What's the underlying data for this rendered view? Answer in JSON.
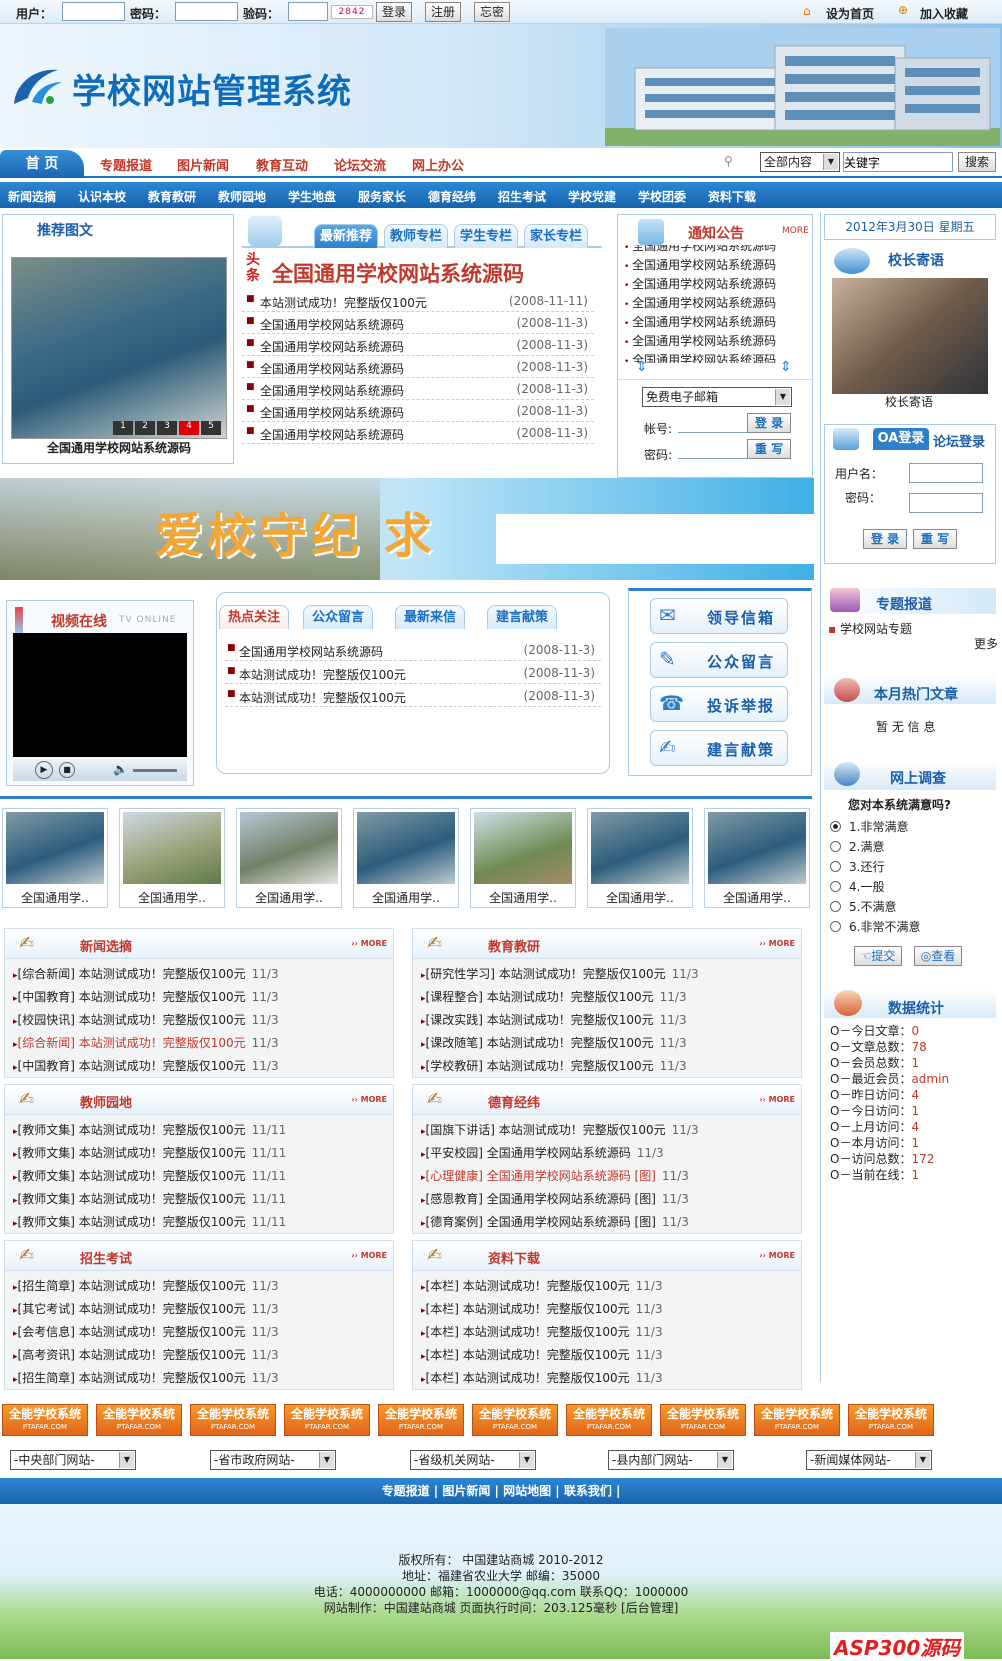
{
  "topbar": {
    "user_label": "用户：",
    "pwd_label": "密码：",
    "code_label": "验码：",
    "captcha": "2842",
    "login": "登录",
    "register": "注册",
    "forgot": "忘密",
    "set_home": "设为首页",
    "favorite": "加入收藏"
  },
  "banner": {
    "title": "学校网站管理系统"
  },
  "nav": {
    "home": "首 页",
    "links": [
      "专题报道",
      "图片新闻",
      "教育互动",
      "论坛交流",
      "网上办公"
    ],
    "search_scope": "全部内容",
    "search_value": "关键字",
    "search_button": "搜索"
  },
  "subnav": [
    "新闻选摘",
    "认识本校",
    "教育教研",
    "教师园地",
    "学生地盘",
    "服务家长",
    "德育经纬",
    "招生考试",
    "学校党建",
    "学校团委",
    "资料下载"
  ],
  "recommend": {
    "title": "推荐图文",
    "caption": "全国通用学校网站系统源码",
    "pages": [
      "1",
      "2",
      "3",
      "4",
      "5"
    ]
  },
  "latest": {
    "tabs": [
      "最新推荐",
      "教师专栏",
      "学生专栏",
      "家长专栏"
    ],
    "headline_tag": "头条",
    "headline": "全国通用学校网站系统源码",
    "items": [
      {
        "title": "本站测试成功！完整版仅100元",
        "date": "(2008-11-11)"
      },
      {
        "title": "全国通用学校网站系统源码",
        "date": "(2008-11-3)"
      },
      {
        "title": "全国通用学校网站系统源码",
        "date": "(2008-11-3)"
      },
      {
        "title": "全国通用学校网站系统源码",
        "date": "(2008-11-3)"
      },
      {
        "title": "全国通用学校网站系统源码",
        "date": "(2008-11-3)"
      },
      {
        "title": "全国通用学校网站系统源码",
        "date": "(2008-11-3)"
      },
      {
        "title": "全国通用学校网站系统源码",
        "date": "(2008-11-3)"
      }
    ]
  },
  "notice": {
    "title": "通知公告",
    "more": "MORE",
    "items": [
      "全国通用学校网站系统源码",
      "全国通用学校网站系统源码",
      "全国通用学校网站系统源码",
      "全国通用学校网站系统源码",
      "全国通用学校网站系统源码",
      "全国通用学校网站系统源码",
      "全国通用学校网站系统源码"
    ],
    "mail_select": "免费电子邮箱",
    "account_label": "帐号:",
    "password_label": "密码:",
    "login": "登 录",
    "reset": "重 写"
  },
  "right": {
    "date": "2012年3月30日 星期五",
    "principal_title": "校长寄语",
    "principal_caption": "校长寄语",
    "oa_tab": "OA登录",
    "forum_tab": "论坛登录",
    "user_label": "用户名：",
    "pwd_label": "密码：",
    "login": "登 录",
    "reset": "重 写",
    "topic_title": "专题报道",
    "topic_item": "学校网站专题",
    "topic_more": "更多",
    "hot_title": "本月热门文章",
    "hot_empty": "暂 无 信 息",
    "survey_title": "网上调查",
    "survey_question": "您对本系统满意吗?",
    "survey_options": [
      "1.非常满意",
      "2.满意",
      "3.还行",
      "4.一般",
      "5.不满意",
      "6.非常不满意"
    ],
    "submit": "提交",
    "view": "查看",
    "stats_title": "数据统计",
    "stats": [
      {
        "label": "O－今日文章：",
        "value": "0"
      },
      {
        "label": "O－文章总数：",
        "value": "78"
      },
      {
        "label": "O－会员总数：",
        "value": "1"
      },
      {
        "label": "O－最近会员：",
        "value": "admin"
      },
      {
        "label": "O－昨日访问：",
        "value": "4"
      },
      {
        "label": "O－今日访问：",
        "value": "1"
      },
      {
        "label": "O－上月访问：",
        "value": "4"
      },
      {
        "label": "O－本月访问：",
        "value": "1"
      },
      {
        "label": "O－访问总数：",
        "value": "172"
      },
      {
        "label": "O－当前在线：",
        "value": "1"
      }
    ]
  },
  "slogan": {
    "text": "爱校守纪 求"
  },
  "video": {
    "title": "视频在线",
    "subtitle": "TV ONLINE"
  },
  "hot": {
    "tabs": [
      "热点关注",
      "公众留言",
      "最新来信",
      "建言献策"
    ],
    "items": [
      {
        "title": "全国通用学校网站系统源码",
        "date": "(2008-11-3)"
      },
      {
        "title": "本站测试成功！完整版仅100元",
        "date": "(2008-11-3)"
      },
      {
        "title": "本站测试成功！完整版仅100元",
        "date": "(2008-11-3)"
      }
    ]
  },
  "service_buttons": [
    "领导信箱",
    "公众留言",
    "投诉举报",
    "建言献策"
  ],
  "thumbs": [
    "全国通用学..",
    "全国通用学..",
    "全国通用学..",
    "全国通用学..",
    "全国通用学..",
    "全国通用学..",
    "全国通用学.."
  ],
  "sections": [
    {
      "title": "新闻选摘",
      "more": "MORE",
      "rows": [
        {
          "text": "[综合新闻] 本站测试成功！完整版仅100元",
          "date": "11/3",
          "red": false
        },
        {
          "text": "[中国教育] 本站测试成功！完整版仅100元",
          "date": "11/3",
          "red": false
        },
        {
          "text": "[校园快讯] 本站测试成功！完整版仅100元",
          "date": "11/3",
          "red": false
        },
        {
          "text": "[综合新闻] 本站测试成功！完整版仅100元",
          "date": "11/3",
          "red": true
        },
        {
          "text": "[中国教育] 本站测试成功！完整版仅100元",
          "date": "11/3",
          "red": false
        }
      ]
    },
    {
      "title": "教育教研",
      "more": "MORE",
      "rows": [
        {
          "text": "[研究性学习] 本站测试成功！完整版仅100元",
          "date": "11/3",
          "red": false
        },
        {
          "text": "[课程整合] 本站测试成功！完整版仅100元",
          "date": "11/3",
          "red": false
        },
        {
          "text": "[课改实践] 本站测试成功！完整版仅100元",
          "date": "11/3",
          "red": false
        },
        {
          "text": "[课改随笔] 本站测试成功！完整版仅100元",
          "date": "11/3",
          "red": false
        },
        {
          "text": "[学校教研] 本站测试成功！完整版仅100元",
          "date": "11/3",
          "red": false
        }
      ]
    },
    {
      "title": "教师园地",
      "more": "MORE",
      "rows": [
        {
          "text": "[教师文集] 本站测试成功！完整版仅100元",
          "date": "11/11",
          "red": false
        },
        {
          "text": "[教师文集] 本站测试成功！完整版仅100元",
          "date": "11/11",
          "red": false
        },
        {
          "text": "[教师文集] 本站测试成功！完整版仅100元",
          "date": "11/11",
          "red": false
        },
        {
          "text": "[教师文集] 本站测试成功！完整版仅100元",
          "date": "11/11",
          "red": false
        },
        {
          "text": "[教师文集] 本站测试成功！完整版仅100元",
          "date": "11/11",
          "red": false
        }
      ]
    },
    {
      "title": "德育经纬",
      "more": "MORE",
      "rows": [
        {
          "text": "[国旗下讲话] 本站测试成功！完整版仅100元",
          "date": "11/3",
          "red": false
        },
        {
          "text": "[平安校园] 全国通用学校网站系统源码",
          "date": "11/3",
          "red": false
        },
        {
          "text": "[心理健康] 全国通用学校网站系统源码 [图]",
          "date": "11/3",
          "red": true
        },
        {
          "text": "[感恩教育] 全国通用学校网站系统源码 [图]",
          "date": "11/3",
          "red": false
        },
        {
          "text": "[德育案例] 全国通用学校网站系统源码 [图]",
          "date": "11/3",
          "red": false
        }
      ]
    },
    {
      "title": "招生考试",
      "more": "MORE",
      "rows": [
        {
          "text": "[招生简章] 本站测试成功！完整版仅100元",
          "date": "11/3",
          "red": false
        },
        {
          "text": "[其它考试] 本站测试成功！完整版仅100元",
          "date": "11/3",
          "red": false
        },
        {
          "text": "[会考信息] 本站测试成功！完整版仅100元",
          "date": "11/3",
          "red": false
        },
        {
          "text": "[高考资讯] 本站测试成功！完整版仅100元",
          "date": "11/3",
          "red": false
        },
        {
          "text": "[招生简章] 本站测试成功！完整版仅100元",
          "date": "11/3",
          "red": false
        }
      ]
    },
    {
      "title": "资料下载",
      "more": "MORE",
      "rows": [
        {
          "text": "[本栏] 本站测试成功！完整版仅100元",
          "date": "11/3",
          "red": false
        },
        {
          "text": "[本栏] 本站测试成功！完整版仅100元",
          "date": "11/3",
          "red": false
        },
        {
          "text": "[本栏] 本站测试成功！完整版仅100元",
          "date": "11/3",
          "red": false
        },
        {
          "text": "[本栏] 本站测试成功！完整版仅100元",
          "date": "11/3",
          "red": false
        },
        {
          "text": "[本栏] 本站测试成功！完整版仅100元",
          "date": "11/3",
          "red": false
        }
      ]
    }
  ],
  "ads": {
    "title": "全能学校系统",
    "sub": "PTAFAR.COM"
  },
  "link_selects": [
    "-中央部门网站-",
    "-省市政府网站-",
    "-省级机关网站-",
    "-县内部门网站-",
    "-新闻媒体网站-"
  ],
  "footer": {
    "links": [
      "专题报道",
      "图片新闻",
      "网站地图",
      "联系我们"
    ],
    "copyright": "版权所有： 中国建站商城 2010-2012",
    "address": "地址：福建省农业大学 邮编：35000",
    "contact": "电话：4000000000 邮箱：1000000@qq.com 联系QQ：1000000",
    "made": "网站制作：中国建站商城 页面执行时间：203.125毫秒 [后台管理]",
    "brand": "ASP300源码"
  },
  "colors": {
    "primary": "#1d76c3",
    "accent_red": "#c0392b",
    "ad_orange": "#f08a24"
  }
}
